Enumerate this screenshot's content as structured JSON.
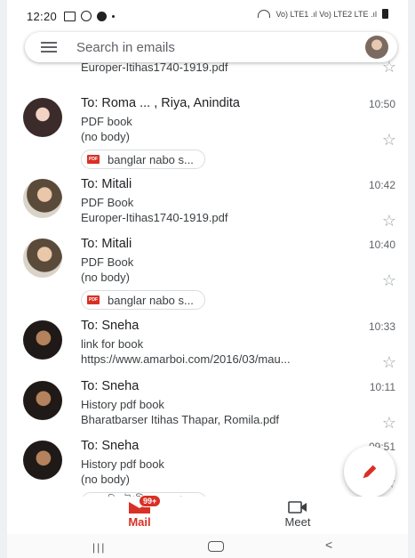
{
  "status_bar": {
    "time": "12:20",
    "right_text": "Vo) LTE1 .ıl Vo) LTE2 LTE .ıl"
  },
  "search": {
    "placeholder": "Search in emails"
  },
  "partial_row": {
    "snippet": "Europer-Itihas1740-1919.pdf"
  },
  "emails": [
    {
      "to": "To: Roma ... , Riya, Anindita",
      "time": "10:50",
      "subject": "PDF book",
      "snippet": "(no body)",
      "attachment": "banglar nabo s..."
    },
    {
      "to": "To: Mitali",
      "time": "10:42",
      "subject": "PDF Book",
      "snippet": "Europer-Itihas1740-1919.pdf",
      "attachment": ""
    },
    {
      "to": "To: Mitali",
      "time": "10:40",
      "subject": "PDF Book",
      "snippet": "(no body)",
      "attachment": "banglar nabo s..."
    },
    {
      "to": "To: Sneha",
      "time": "10:33",
      "subject": "link for book",
      "snippet": "https://www.amarboi.com/2016/03/mau...",
      "attachment": ""
    },
    {
      "to": "To: Sneha",
      "time": "10:11",
      "subject": "History pdf book",
      "snippet": "Bharatbarser Itihas Thapar, Romila.pdf",
      "attachment": ""
    },
    {
      "to": "To: Sneha",
      "time": "09:51",
      "subject": "History pdf book",
      "snippet": "(no body)",
      "attachment": "হিস্টোরী অফ দ্যা ..."
    }
  ],
  "attachment_icon_label": "PDF",
  "bottom_nav": {
    "mail_label": "Mail",
    "mail_badge": "99+",
    "meet_label": "Meet"
  },
  "colors": {
    "accent": "#d93025",
    "text": "#202124",
    "secondary": "#5f6368"
  }
}
